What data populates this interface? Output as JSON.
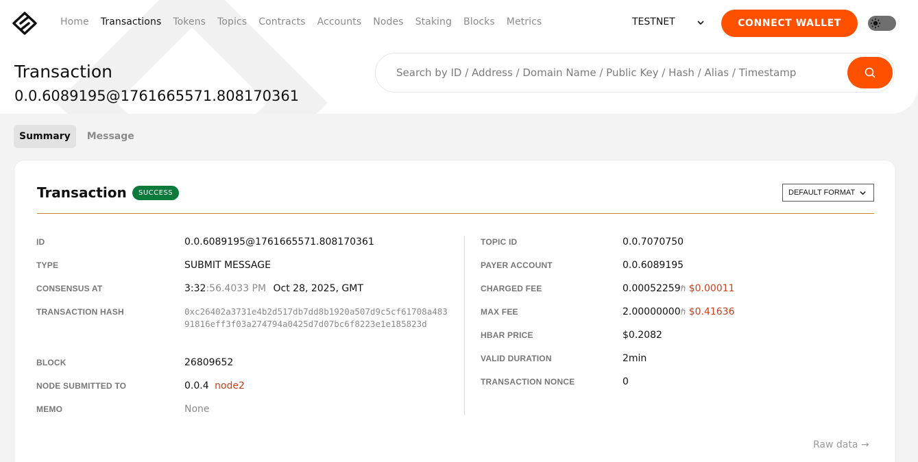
{
  "nav": {
    "items": [
      "Home",
      "Transactions",
      "Tokens",
      "Topics",
      "Contracts",
      "Accounts",
      "Nodes",
      "Staking",
      "Blocks",
      "Metrics"
    ],
    "active": "Transactions"
  },
  "network": {
    "selected": "TESTNET"
  },
  "connect_label": "CONNECT WALLET",
  "page": {
    "title": "Transaction",
    "subtitle": "0.0.6089195@1761665571.808170361"
  },
  "search": {
    "placeholder": "Search by ID / Address / Domain Name / Public Key / Hash / Alias / Timestamp"
  },
  "tabs": [
    "Summary",
    "Message"
  ],
  "card": {
    "title": "Transaction",
    "status": "SUCCESS",
    "format": "DEFAULT FORMAT",
    "left": {
      "id_label": "ID",
      "id_value": "0.0.6089195@1761665571.808170361",
      "type_label": "TYPE",
      "type_value": "SUBMIT MESSAGE",
      "consensus_label": "CONSENSUS AT",
      "consensus_time": "3:32",
      "consensus_time_fraction": ":56.4033 PM",
      "consensus_date": "Oct 28, 2025, GMT",
      "hash_label": "TRANSACTION HASH",
      "hash_value": "0xc26402a3731e4b2d517db7dd8b1920a507d9c5cf61708a48391816eff3f03a274794a0425d7d07bc6f8223e1e185823d",
      "block_label": "BLOCK",
      "block_value": "26809652",
      "node_label": "NODE SUBMITTED TO",
      "node_id": "0.0.4",
      "node_name": "node2",
      "memo_label": "MEMO",
      "memo_value": "None"
    },
    "right": {
      "topic_label": "TOPIC ID",
      "topic_value": "0.0.7070750",
      "payer_label": "PAYER ACCOUNT",
      "payer_value": "0.0.6089195",
      "charged_label": "CHARGED FEE",
      "charged_hbar": "0.00052259",
      "charged_usd": "$0.00011",
      "maxfee_label": "MAX FEE",
      "maxfee_hbar": "2.00000000",
      "maxfee_usd": "$0.41636",
      "hbarprice_label": "HBAR PRICE",
      "hbarprice_value": "$0.2082",
      "duration_label": "VALID DURATION",
      "duration_value": "2min",
      "nonce_label": "TRANSACTION NONCE",
      "nonce_value": "0",
      "hbar_symbol": "ℏ"
    },
    "raw_label": "Raw data →"
  },
  "colors": {
    "accent": "#fe5100",
    "success": "#0b7a3b",
    "link": "#c8401e"
  }
}
